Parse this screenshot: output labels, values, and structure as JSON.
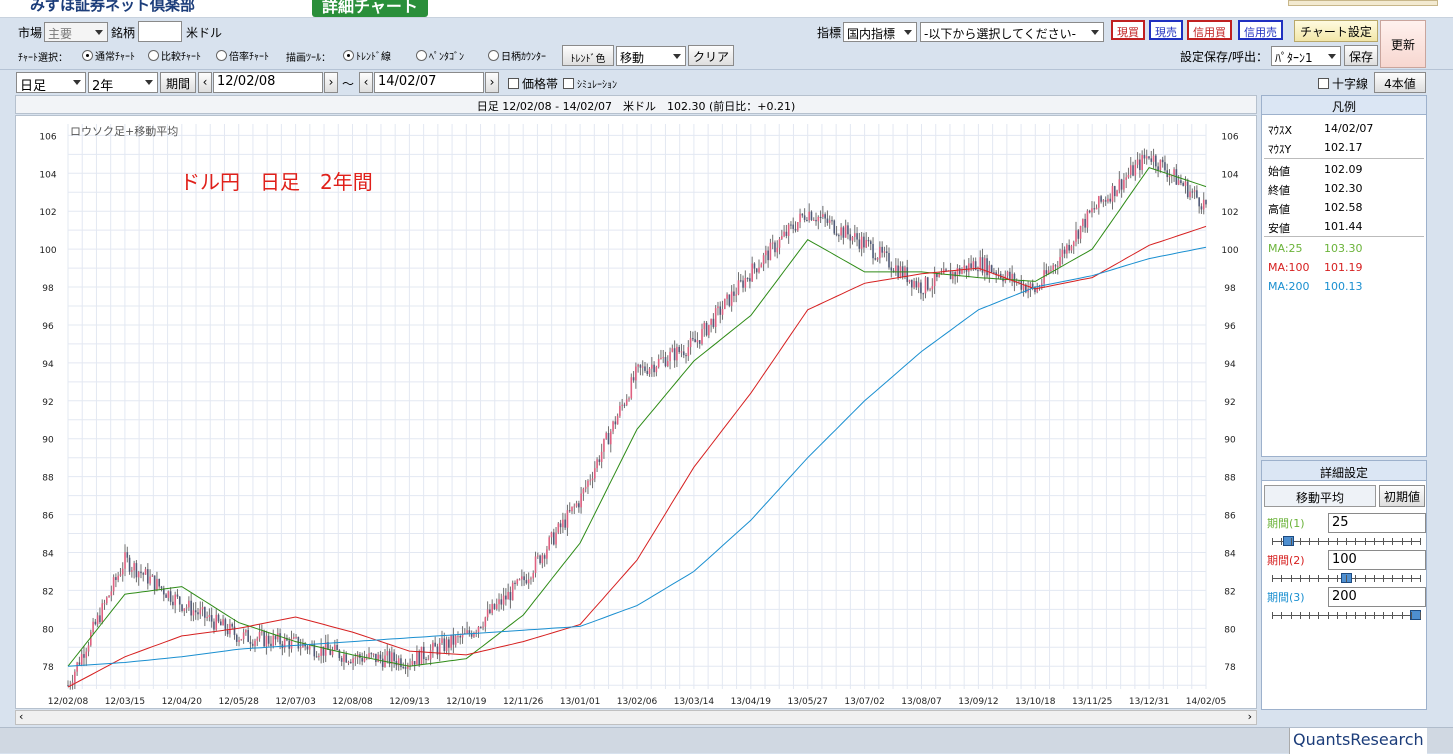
{
  "brand": {
    "name": "みずほ証券ネット倶楽部",
    "app_title": "詳細チャート"
  },
  "toolbar1": {
    "market_label": "市場",
    "market_value": "主要",
    "symbol_label": "銘柄",
    "symbol_value": "",
    "symbol_name": "米ドル",
    "indicator_label": "指標",
    "indicator_value": "国内指標",
    "indicator_select": "-以下から選択してください-",
    "btn_buy": "現買",
    "btn_sell": "現売",
    "btn_margin_buy": "信用買",
    "btn_margin_sell": "信用売",
    "btn_chart_settings": "チャート設定",
    "btn_refresh": "更新"
  },
  "toolbar2": {
    "chart_select_label": "ﾁｬｰﾄ選択：",
    "radio_normal": "通常ﾁｬｰﾄ",
    "radio_compare": "比較ﾁｬｰﾄ",
    "radio_ratio": "倍率ﾁｬｰﾄ",
    "draw_tool_label": "描画ﾂｰﾙ：",
    "radio_trend": "ﾄﾚﾝﾄﾞ線",
    "radio_pentagon": "ﾍﾟﾝﾀｺﾞﾝ",
    "radio_counter": "日柄ｶｳﾝﾀｰ",
    "trend_color_btn": "ﾄﾚﾝﾄﾞ色",
    "move_value": "移動",
    "clear_btn": "クリア",
    "save_label": "設定保存/呼出：",
    "pattern_value": "ﾊﾟﾀｰﾝ1",
    "save_btn": "保存"
  },
  "toolbar3": {
    "period_type": "日足",
    "span": "2年",
    "period_btn": "期間",
    "from_date": "12/02/08",
    "tilde": "～",
    "to_date": "14/02/07",
    "price_band_label": "価格帯",
    "simulation_label": "ｼﾐｭﾚｰｼｮﾝ",
    "crosshair_label": "十字線",
    "four_values_btn": "4本値"
  },
  "chart_header": "日足 12/02/08 - 14/02/07　米ドル　102.30 (前日比：+0.21)",
  "chart_inner_label": "ロウソク足+移動平均",
  "annotation": "ドル円　日足　2年間",
  "chart_data": {
    "type": "line",
    "candles_note_dropped": false,
    "x": [
      "12/02/08",
      "12/03/15",
      "12/04/20",
      "12/05/28",
      "12/07/03",
      "12/08/08",
      "12/09/13",
      "12/10/19",
      "12/11/26",
      "13/01/01",
      "13/02/06",
      "13/03/14",
      "13/04/19",
      "13/05/27",
      "13/07/02",
      "13/08/07",
      "13/09/12",
      "13/10/18",
      "13/11/25",
      "13/12/31",
      "14/02/05"
    ],
    "ylim": [
      76.8,
      106.6
    ],
    "y_ticks": [
      78,
      80,
      82,
      84,
      86,
      88,
      90,
      92,
      94,
      96,
      98,
      100,
      102,
      104,
      106
    ],
    "series": [
      {
        "name": "ロウソク足",
        "color": "#8c8c8c",
        "values": [
          77.0,
          83.6,
          81.3,
          79.6,
          79.2,
          78.5,
          78.3,
          79.6,
          82.5,
          86.8,
          93.5,
          95.0,
          98.8,
          102.0,
          100.3,
          98.0,
          99.3,
          97.8,
          102.0,
          105.0,
          102.3
        ]
      },
      {
        "name": "MA:25",
        "color": "#2e8b16",
        "values": [
          78.0,
          81.8,
          82.2,
          80.3,
          79.3,
          78.6,
          78.0,
          78.4,
          80.7,
          84.5,
          90.5,
          94.1,
          96.5,
          100.5,
          98.8,
          98.8,
          98.5,
          98.3,
          100.0,
          104.3,
          103.3
        ]
      },
      {
        "name": "MA:100",
        "color": "#d62020",
        "values": [
          76.9,
          78.5,
          79.6,
          80.0,
          80.6,
          79.8,
          78.8,
          78.6,
          79.3,
          80.2,
          83.6,
          88.5,
          92.4,
          96.8,
          98.2,
          98.7,
          99.0,
          97.9,
          98.5,
          100.2,
          101.2
        ]
      },
      {
        "name": "MA:200",
        "color": "#1a8fd0",
        "values": [
          78.0,
          78.2,
          78.5,
          78.9,
          79.1,
          79.3,
          79.5,
          79.7,
          79.9,
          80.1,
          81.2,
          83.0,
          85.7,
          89.0,
          92.0,
          94.6,
          96.8,
          98.0,
          98.6,
          99.5,
          100.1
        ]
      }
    ]
  },
  "legend": {
    "title": "凡例",
    "mouse_x_label": "ﾏｳｽX",
    "mouse_x_value": "14/02/07",
    "mouse_y_label": "ﾏｳｽY",
    "mouse_y_value": "102.17",
    "open_label": "始値",
    "open_value": "102.09",
    "close_label": "終値",
    "close_value": "102.30",
    "high_label": "高値",
    "high_value": "102.58",
    "low_label": "安値",
    "low_value": "101.44",
    "ma1_label": "MA:25",
    "ma1_value": "103.30",
    "ma2_label": "MA:100",
    "ma2_value": "101.19",
    "ma3_label": "MA:200",
    "ma3_value": "100.13"
  },
  "details": {
    "title": "詳細設定",
    "tab_ma": "移動平均",
    "btn_init": "初期値",
    "period1_label": "期間(1)",
    "period1_value": "25",
    "period2_label": "期間(2)",
    "period2_value": "100",
    "period3_label": "期間(3)",
    "period3_value": "200"
  },
  "sliders": {
    "period1": 0.08,
    "period2": 0.5,
    "period3": 1.0
  },
  "footer": {
    "brand": "QuantsResearch"
  },
  "colors": {
    "ma25": "#2e8b16",
    "ma100": "#d62020",
    "ma200": "#1a8fd0",
    "annotation": "#e0201a"
  }
}
